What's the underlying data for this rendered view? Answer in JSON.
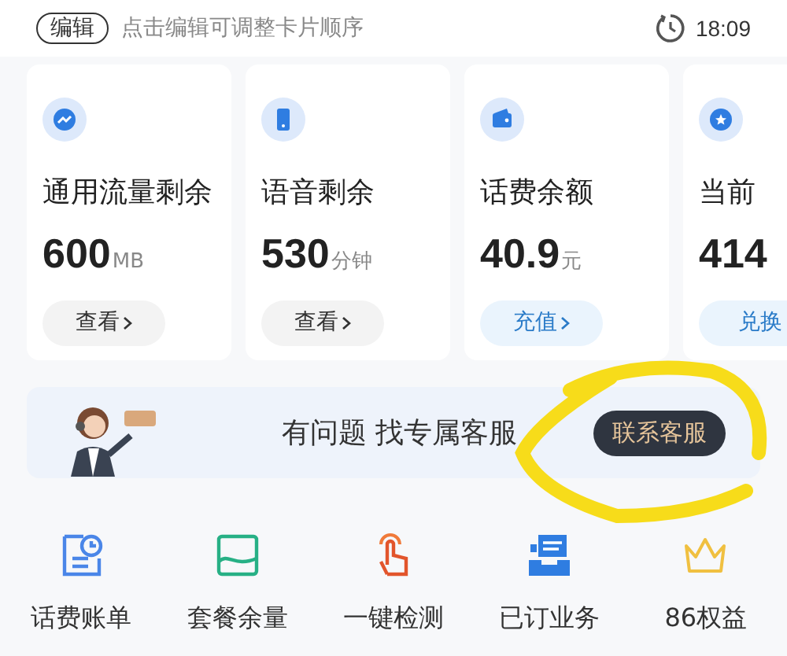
{
  "header": {
    "edit_label": "编辑",
    "hint": "点击编辑可调整卡片顺序",
    "time": "18:09"
  },
  "cards": [
    {
      "title": "通用流量剩余",
      "value": "600",
      "unit": "MB",
      "action": "查看",
      "accent": false,
      "chevron": true
    },
    {
      "title": "语音剩余",
      "value": "530",
      "unit": "分钟",
      "action": "查看",
      "accent": false,
      "chevron": true
    },
    {
      "title": "话费余额",
      "value": "40.9",
      "unit": "元",
      "action": "充值",
      "accent": true,
      "chevron": true
    },
    {
      "title": "当前",
      "value": "414",
      "action": "兑换",
      "accent": true,
      "chevron": false
    }
  ],
  "service_banner": {
    "message": "有问题 找专属客服",
    "button": "联系客服"
  },
  "shortcuts": [
    {
      "label": "话费账单"
    },
    {
      "label": "套餐余量"
    },
    {
      "label": "一键检测"
    },
    {
      "label": "已订业务"
    },
    {
      "label": "86权益"
    }
  ]
}
